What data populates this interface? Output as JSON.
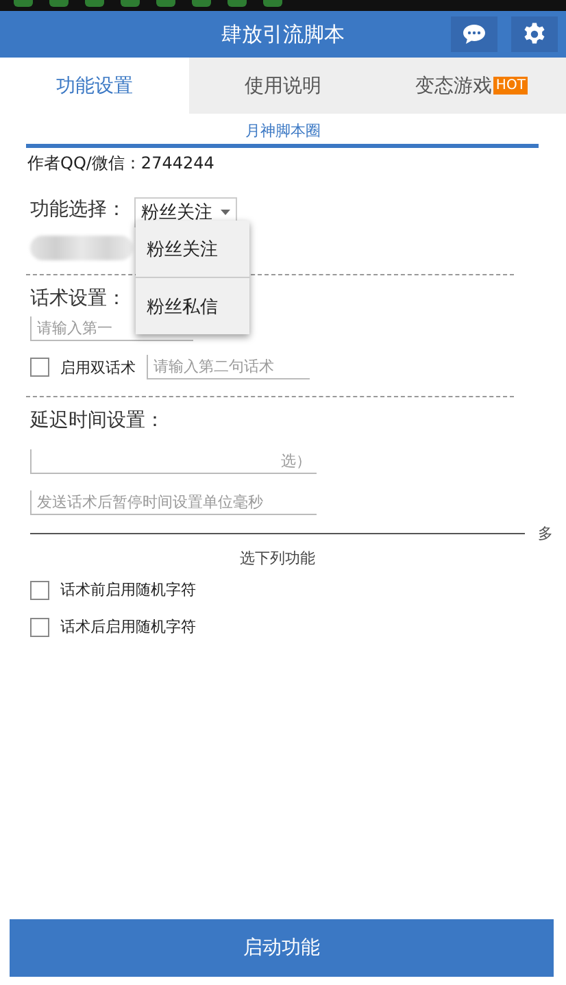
{
  "header": {
    "title": "肆放引流脚本"
  },
  "tabs": [
    {
      "label": "功能设置",
      "selected": true
    },
    {
      "label": "使用说明",
      "selected": false
    },
    {
      "label": "变态游戏",
      "selected": false,
      "badge": "HOT"
    }
  ],
  "banner_link": "月神脚本圈",
  "author": "作者QQ/微信：2744244",
  "function_select": {
    "label": "功能选择：",
    "value": "粉丝关注",
    "expanded": true,
    "options": [
      {
        "label": "粉丝关注"
      },
      {
        "label": "粉丝私信"
      }
    ]
  },
  "script_settings": {
    "label": "话术设置：",
    "first_placeholder": "请输入第一",
    "dual": {
      "label": "启用双话术",
      "checked": false,
      "placeholder": "请输入第二句话术"
    }
  },
  "delay": {
    "label": "延迟时间设置：",
    "fields": [
      {
        "placeholder": "选）"
      },
      {
        "placeholder": "发送话术后暂停时间设置单位毫秒"
      }
    ],
    "side_note": "多",
    "hint": "选下列功能"
  },
  "options": [
    {
      "label": "话术前启用随机字符",
      "checked": false
    },
    {
      "label": "话术后启用随机字符",
      "checked": false
    }
  ],
  "start_button": "启动功能"
}
